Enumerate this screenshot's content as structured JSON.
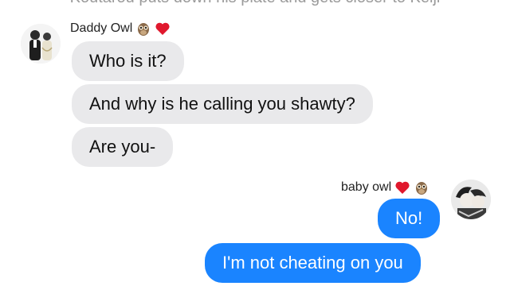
{
  "narration": "Koutarou puts down his plate and gets closer to Keiji",
  "contacts": {
    "left": {
      "name": "Daddy Owl",
      "emojis": [
        "owl-emoji",
        "red-heart-emoji"
      ]
    },
    "right": {
      "name": "baby owl",
      "emojis": [
        "red-heart-emoji",
        "owl-emoji"
      ]
    }
  },
  "messages": [
    {
      "side": "incoming",
      "text": "Who is it?"
    },
    {
      "side": "incoming",
      "text": "And why is he calling you shawty?"
    },
    {
      "side": "incoming",
      "text": "Are you-"
    },
    {
      "side": "outgoing",
      "text": "No!"
    },
    {
      "side": "outgoing",
      "text": "I'm not cheating on you"
    }
  ],
  "colors": {
    "incoming_bubble": "#e9e9eb",
    "outgoing_bubble": "#1a84ff",
    "narration_text": "#9b9b9b"
  }
}
